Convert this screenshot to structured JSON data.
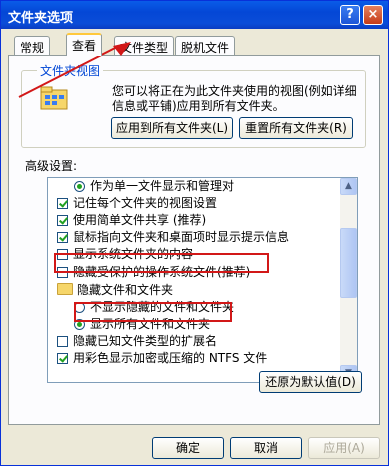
{
  "window": {
    "title": "文件夹选项",
    "help_label": "?",
    "close_label": "×"
  },
  "tabs": [
    {
      "label": "常规"
    },
    {
      "label": "查看"
    },
    {
      "label": "文件类型"
    },
    {
      "label": "脱机文件"
    }
  ],
  "folder_views": {
    "group_label": "文件夹视图",
    "description": "您可以将正在为此文件夹使用的视图(例如详细信息或平铺)应用到所有文件夹。",
    "apply_all_label": "应用到所有文件夹(L)",
    "reset_all_label": "重置所有文件夹(R)"
  },
  "advanced": {
    "label": "高级设置:",
    "items": [
      {
        "type": "radio",
        "checked": true,
        "indent": 2,
        "label": "作为单一文件显示和管理对"
      },
      {
        "type": "checkbox",
        "checked": true,
        "indent": 1,
        "label": "记住每个文件夹的视图设置"
      },
      {
        "type": "checkbox",
        "checked": true,
        "indent": 1,
        "label": "使用简单文件共享 (推荐)"
      },
      {
        "type": "checkbox",
        "checked": true,
        "indent": 1,
        "label": "鼠标指向文件夹和桌面项时显示提示信息"
      },
      {
        "type": "checkbox",
        "checked": false,
        "indent": 1,
        "label": "显示系统文件夹的内容"
      },
      {
        "type": "checkbox",
        "checked": false,
        "indent": 1,
        "label": "隐藏受保护的操作系统文件(推荐)"
      },
      {
        "type": "folder",
        "checked": false,
        "indent": 1,
        "label": "隐藏文件和文件夹"
      },
      {
        "type": "radio",
        "checked": false,
        "indent": 2,
        "label": "不显示隐藏的文件和文件夹"
      },
      {
        "type": "radio",
        "checked": true,
        "indent": 2,
        "label": "显示所有文件和文件夹"
      },
      {
        "type": "checkbox",
        "checked": false,
        "indent": 1,
        "label": "隐藏已知文件类型的扩展名"
      },
      {
        "type": "checkbox",
        "checked": true,
        "indent": 1,
        "label": "用彩色显示加密或压缩的 NTFS 文件"
      }
    ],
    "restore_defaults_label": "还原为默认值(D)"
  },
  "footer": {
    "ok_label": "确定",
    "cancel_label": "取消",
    "apply_label": "应用(A)"
  },
  "colors": {
    "annotation": "#d21818",
    "titlebar": "#0a4dd8"
  }
}
